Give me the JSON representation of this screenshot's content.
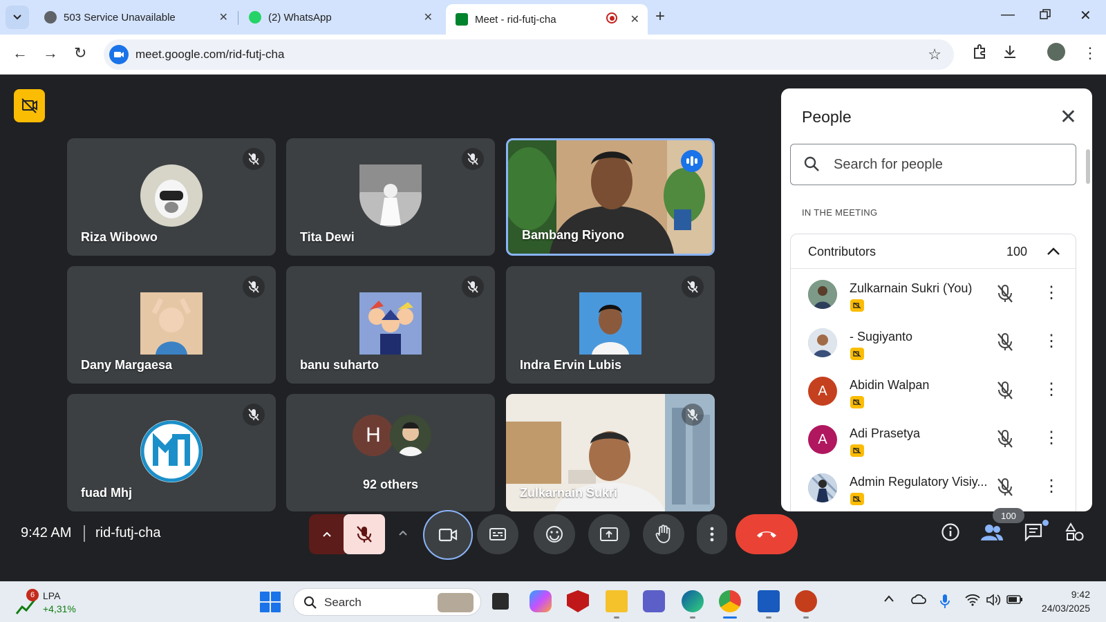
{
  "browser": {
    "tabs": [
      {
        "title": "503 Service Unavailable",
        "active": false
      },
      {
        "title": "(2) WhatsApp",
        "active": false
      },
      {
        "title": "Meet - rid-futj-cha",
        "active": true
      }
    ],
    "url": "meet.google.com/rid-futj-cha"
  },
  "meeting": {
    "time": "9:42 AM",
    "code": "rid-futj-cha",
    "tiles": [
      {
        "name": "Riza Wibowo",
        "avatar_color": "#d7d4c8",
        "muted": true
      },
      {
        "name": "Tita Dewi",
        "avatar_color": "#bdbdbd",
        "muted": true
      },
      {
        "name": "Bambang Riyono",
        "video": true,
        "speaking": true
      },
      {
        "name": "Dany Margaesa",
        "avatar_color": "#d9b38c",
        "muted": true
      },
      {
        "name": "banu suharto",
        "avatar_color": "#6b7fb5",
        "muted": true
      },
      {
        "name": "Indra Ervin Lubis",
        "avatar_color": "#3f8fd6",
        "muted": true
      },
      {
        "name": "fuad Mhj",
        "avatar_color": "#ffffff",
        "muted": true
      },
      {
        "name": "92 others",
        "group_initial": "H"
      },
      {
        "name": "Zulkarnain Sukri",
        "video": true,
        "muted": true
      }
    ]
  },
  "people_panel": {
    "title": "People",
    "search_placeholder": "Search for people",
    "section_label": "IN THE MEETING",
    "group_title": "Contributors",
    "group_count": "100",
    "people": [
      {
        "name": "Zulkarnain Sukri (You)",
        "initial": "",
        "avatar_color": "#5d7b6a"
      },
      {
        "name": "- Sugiyanto",
        "initial": "",
        "avatar_color": "#9aa7b8"
      },
      {
        "name": "Abidin Walpan",
        "initial": "A",
        "avatar_color": "#c5401f"
      },
      {
        "name": "Adi Prasetya",
        "initial": "A",
        "avatar_color": "#b0175f"
      },
      {
        "name": "Admin Regulatory Visiy...",
        "initial": "",
        "avatar_color": "#6d8db8"
      }
    ]
  },
  "controls": {
    "participant_count": "100"
  },
  "taskbar": {
    "stock_badge": "6",
    "stock_name": "LPA",
    "stock_change": "+4,31%",
    "search_label": "Search",
    "time": "9:42",
    "date": "24/03/2025"
  },
  "colors": {
    "meet_bg": "#202124",
    "tile_bg": "#3c4043",
    "accent_blue": "#1a73e8",
    "hangup_red": "#ea4335",
    "badge_yellow": "#fbbc04"
  }
}
